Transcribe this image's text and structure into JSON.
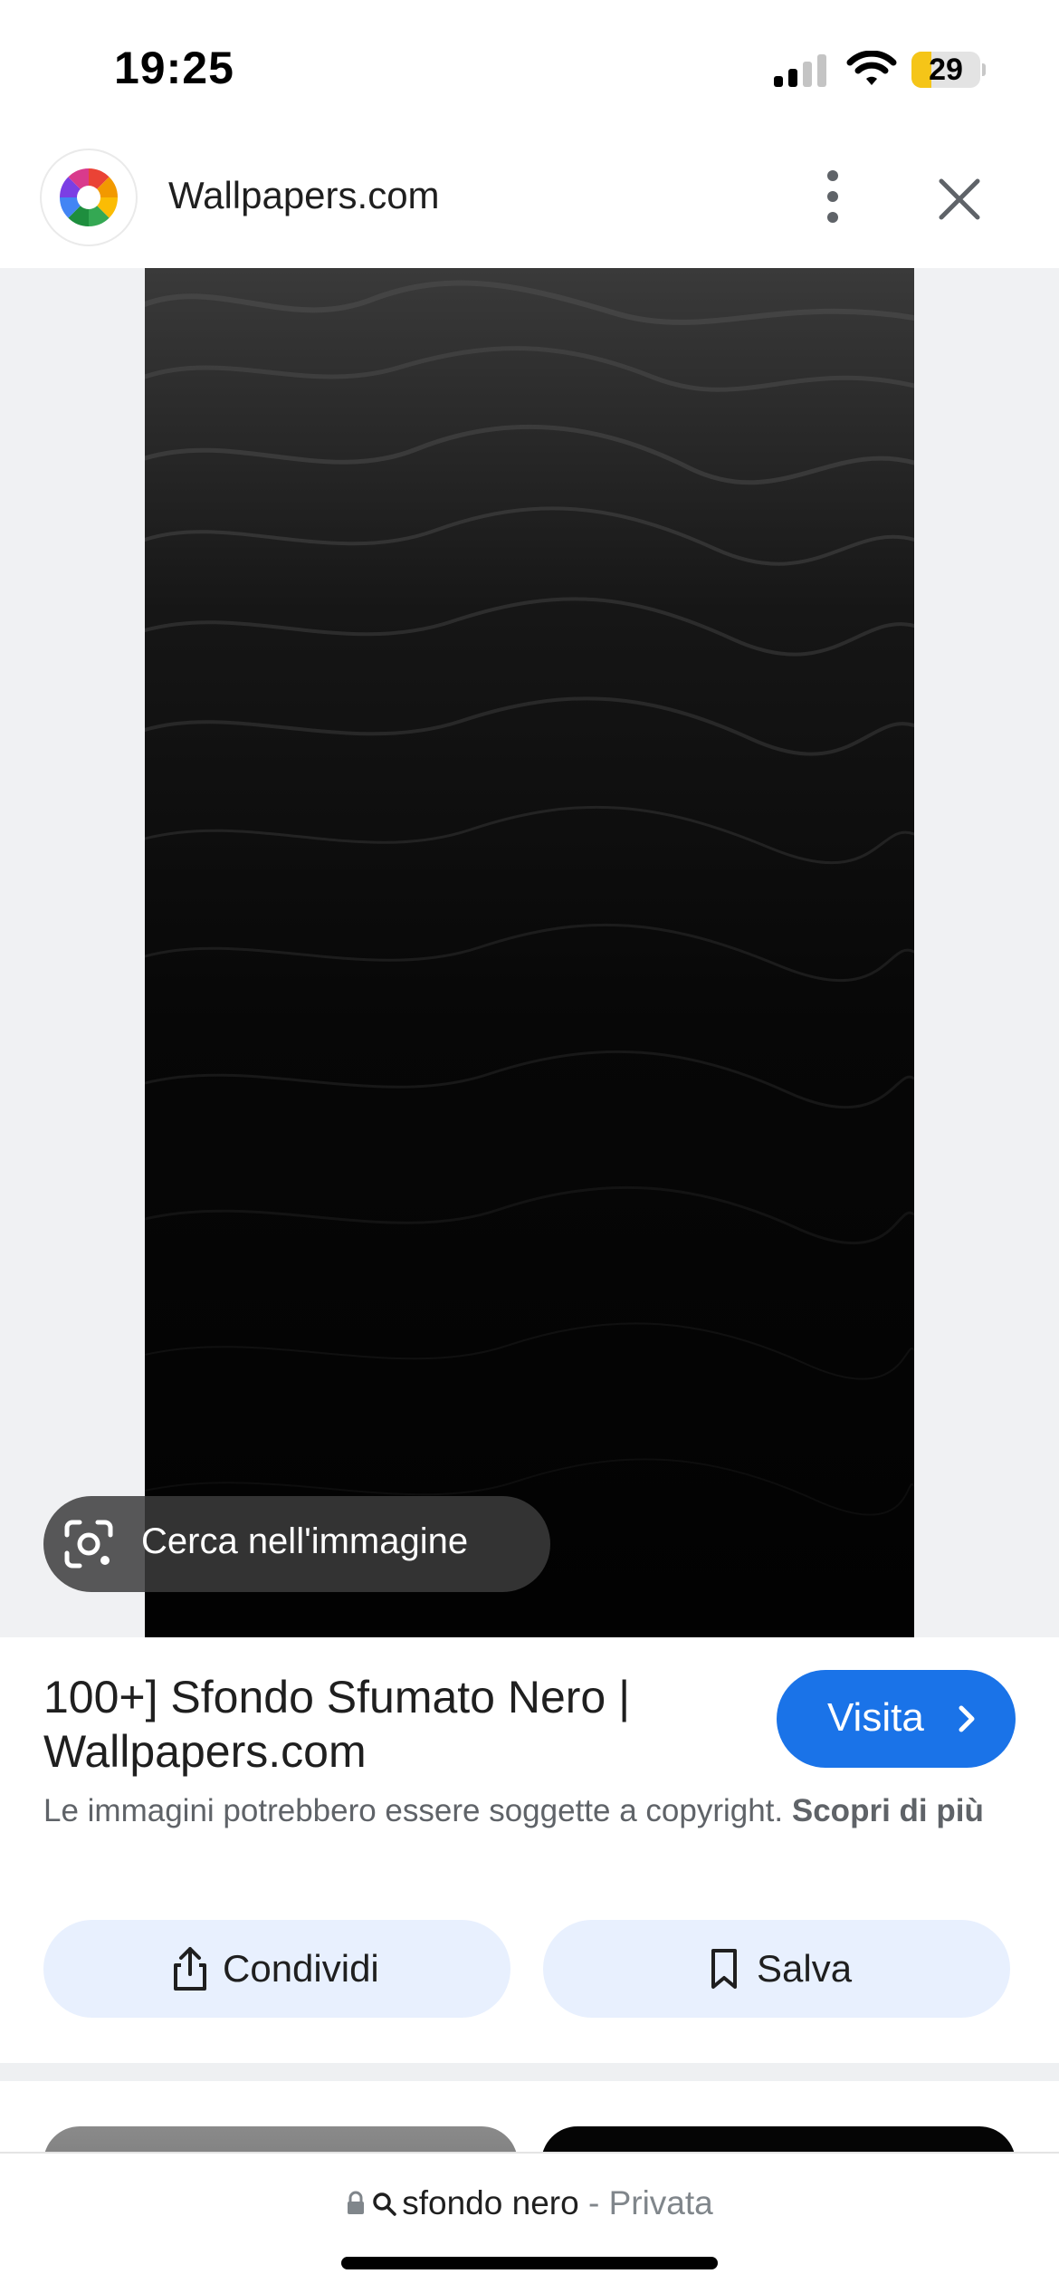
{
  "status_bar": {
    "time": "19:25",
    "battery_level": "29",
    "battery_color": "#f5c518",
    "signal_bars_active": 2,
    "signal_bars_total": 4
  },
  "header": {
    "site_name": "Wallpapers.com",
    "logo_icon": "color-wheel-icon",
    "more_icon": "more-vert-icon",
    "close_icon": "close-icon"
  },
  "image": {
    "description_icon": "image",
    "lens_label": "Cerca nell'immagine",
    "lens_icon": "google-lens-icon"
  },
  "result": {
    "title": "100+] Sfondo Sfumato Nero | Wallpapers.com",
    "visit_label": "Visita",
    "visit_color": "#1a73e8",
    "copyright_text": "Le immagini potrebbero essere soggette a copyright.",
    "learn_more": "Scopri di più"
  },
  "actions": {
    "share_label": "Condividi",
    "share_icon": "share-icon",
    "save_label": "Salva",
    "save_icon": "bookmark-icon"
  },
  "bottom_bar": {
    "query": "sfondo nero",
    "separator": "-",
    "privacy_label": "Privata",
    "lock_icon": "lock-icon",
    "search_icon": "search-icon"
  }
}
